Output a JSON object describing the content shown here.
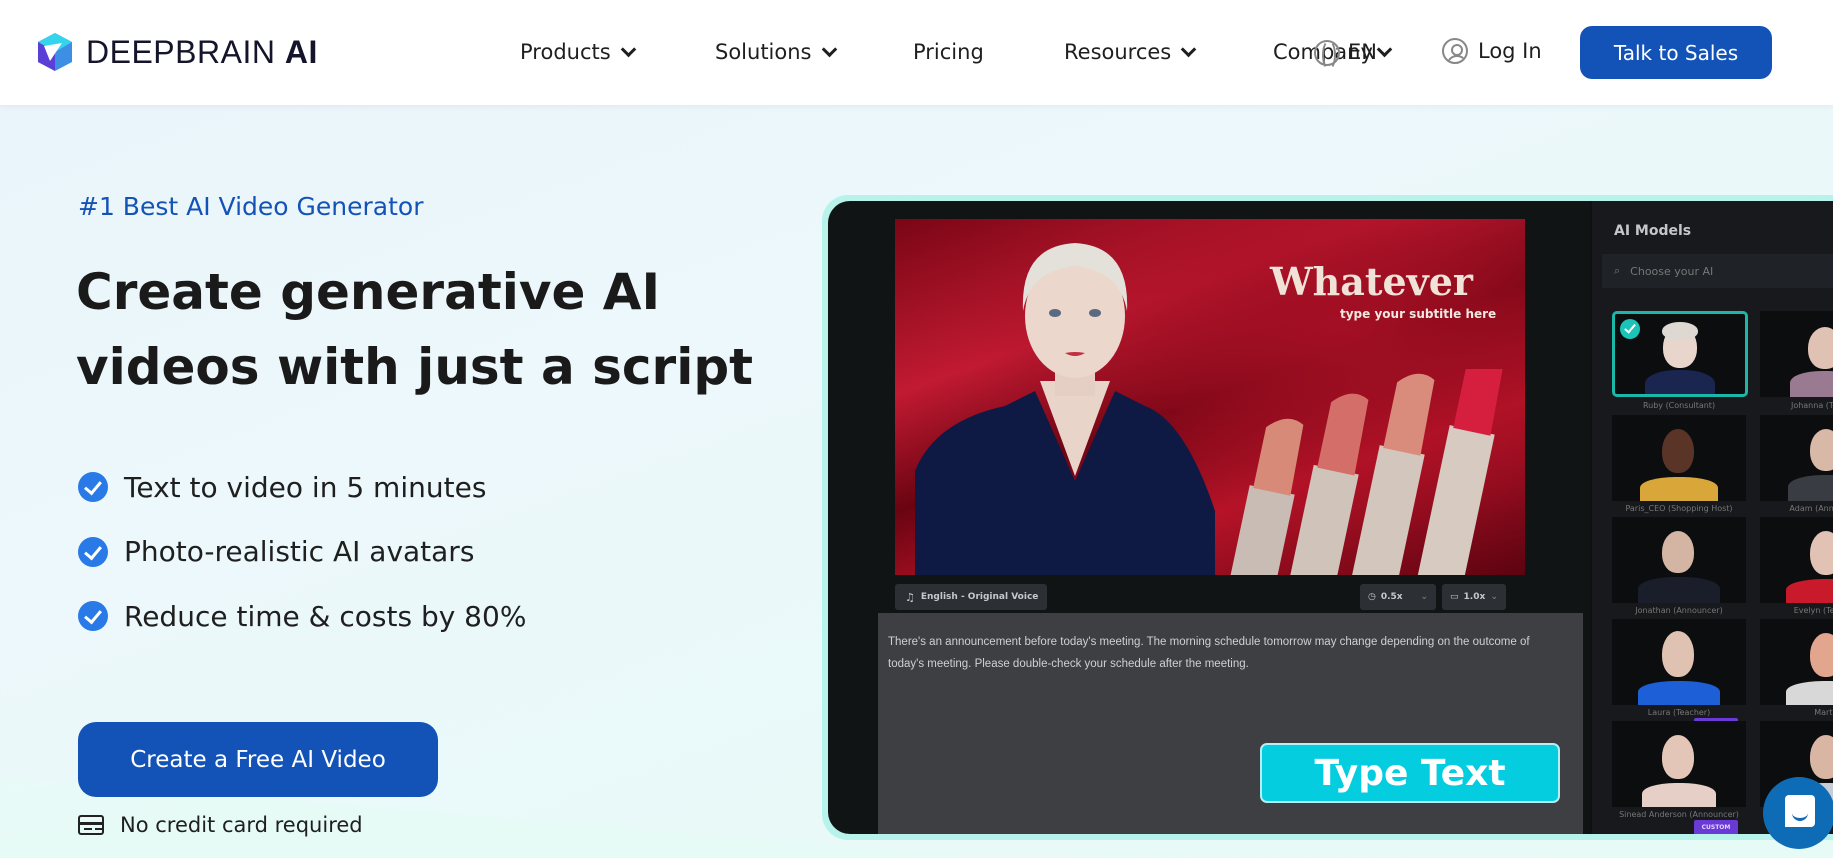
{
  "brand": {
    "name": "DEEPBRAIN",
    "suffix": "AI"
  },
  "nav": {
    "items": [
      {
        "label": "Products",
        "has_dropdown": true
      },
      {
        "label": "Solutions",
        "has_dropdown": true
      },
      {
        "label": "Pricing",
        "has_dropdown": false
      },
      {
        "label": "Resources",
        "has_dropdown": true
      },
      {
        "label": "Company",
        "has_dropdown": true
      }
    ],
    "language": "EN",
    "login_label": "Log In",
    "cta_label": "Talk to Sales"
  },
  "hero": {
    "eyebrow": "#1 Best AI Video Generator",
    "title_line1": "Create generative AI",
    "title_line2": "videos with just a script",
    "bullets": [
      "Text to video in 5 minutes",
      "Photo-realistic AI avatars",
      "Reduce time & costs by 80%"
    ],
    "cta_label": "Create a Free AI Video",
    "note": "No credit card required"
  },
  "demo": {
    "video_title": "Whatever",
    "video_subtitle": "type your subtitle here",
    "voice_label": "English - Original Voice",
    "speed_label": "0.5x",
    "rate_label": "1.0x",
    "script_text": "There's an announcement before today's meeting. The morning schedule tomorrow may change depending on the outcome of today's meeting. Please double-check your schedule after the meeting.",
    "type_text_label": "Type Text",
    "sidebar": {
      "title": "AI Models",
      "search_placeholder": "Choose your AI",
      "models": [
        {
          "label": "Ruby (Consultant)",
          "selected": true
        },
        {
          "label": "Johanna (Teacher)",
          "selected": false
        },
        {
          "label": "Paris_CEO (Shopping Host)",
          "selected": false
        },
        {
          "label": "Adam (Announcer)",
          "selected": false
        },
        {
          "label": "Jonathan (Announcer)",
          "selected": false
        },
        {
          "label": "Evelyn (Teacher)",
          "selected": false
        },
        {
          "label": "Laura (Teacher)",
          "selected": false
        },
        {
          "label": "Martin",
          "selected": false
        },
        {
          "label": "Sinead Anderson (Announcer)",
          "selected": false
        },
        {
          "label": "",
          "selected": false
        }
      ],
      "custom_badge": "CUSTOM"
    }
  },
  "colors": {
    "brand_blue": "#1353b8",
    "check_blue": "#2979e6",
    "accent_cyan": "#05cde0",
    "frame_mint": "#b7f3ea"
  }
}
